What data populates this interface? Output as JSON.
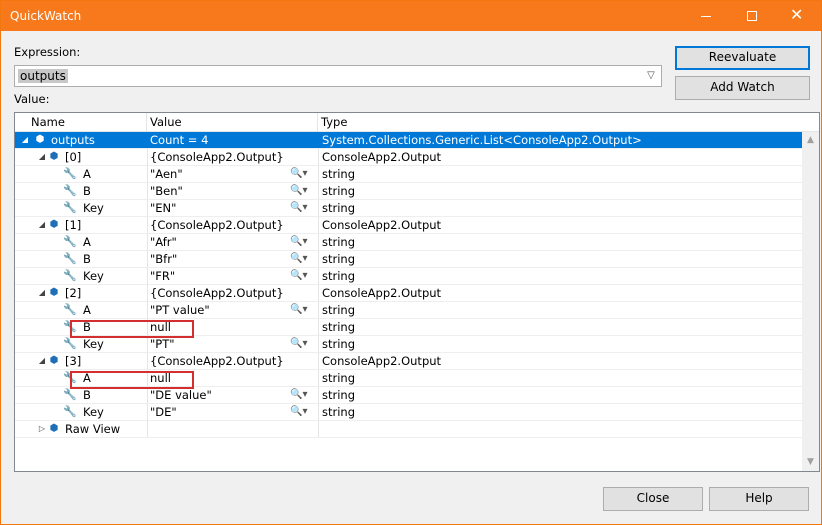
{
  "window": {
    "title": "QuickWatch"
  },
  "expression": {
    "label": "Expression:",
    "value": "outputs"
  },
  "value_label": "Value:",
  "buttons": {
    "reevaluate": "Reevaluate",
    "add_watch": "Add Watch",
    "close": "Close",
    "help": "Help"
  },
  "grid": {
    "columns": [
      "Name",
      "Value",
      "Type"
    ],
    "rows": [
      {
        "name": "outputs",
        "value": "Count = 4",
        "type": "System.Collections.Generic.List<ConsoleApp2.Output>",
        "icon": "object-icon",
        "expander": "expanded",
        "level": 0,
        "selected": true
      },
      {
        "name": "[0]",
        "value": "{ConsoleApp2.Output}",
        "type": "ConsoleApp2.Output",
        "icon": "object-icon",
        "expander": "expanded",
        "level": 1
      },
      {
        "name": "A",
        "value": "\"Aen\"",
        "type": "string",
        "icon": "wrench-icon",
        "level": 2,
        "magnifier": true
      },
      {
        "name": "B",
        "value": "\"Ben\"",
        "type": "string",
        "icon": "wrench-icon",
        "level": 2,
        "magnifier": true
      },
      {
        "name": "Key",
        "value": "\"EN\"",
        "type": "string",
        "icon": "wrench-icon",
        "level": 2,
        "magnifier": true
      },
      {
        "name": "[1]",
        "value": "{ConsoleApp2.Output}",
        "type": "ConsoleApp2.Output",
        "icon": "object-icon",
        "expander": "expanded",
        "level": 1
      },
      {
        "name": "A",
        "value": "\"Afr\"",
        "type": "string",
        "icon": "wrench-icon",
        "level": 2,
        "magnifier": true
      },
      {
        "name": "B",
        "value": "\"Bfr\"",
        "type": "string",
        "icon": "wrench-icon",
        "level": 2,
        "magnifier": true
      },
      {
        "name": "Key",
        "value": "\"FR\"",
        "type": "string",
        "icon": "wrench-icon",
        "level": 2,
        "magnifier": true
      },
      {
        "name": "[2]",
        "value": "{ConsoleApp2.Output}",
        "type": "ConsoleApp2.Output",
        "icon": "object-icon",
        "expander": "expanded",
        "level": 1
      },
      {
        "name": "A",
        "value": "\"PT value\"",
        "type": "string",
        "icon": "wrench-icon",
        "level": 2,
        "magnifier": true
      },
      {
        "name": "B",
        "value": "null",
        "type": "string",
        "icon": "wrench-icon",
        "level": 2,
        "highlighted": true
      },
      {
        "name": "Key",
        "value": "\"PT\"",
        "type": "string",
        "icon": "wrench-icon",
        "level": 2,
        "magnifier": true
      },
      {
        "name": "[3]",
        "value": "{ConsoleApp2.Output}",
        "type": "ConsoleApp2.Output",
        "icon": "object-icon",
        "expander": "expanded",
        "level": 1
      },
      {
        "name": "A",
        "value": "null",
        "type": "string",
        "icon": "wrench-icon",
        "level": 2,
        "highlighted": true
      },
      {
        "name": "B",
        "value": "\"DE value\"",
        "type": "string",
        "icon": "wrench-icon",
        "level": 2,
        "magnifier": true
      },
      {
        "name": "Key",
        "value": "\"DE\"",
        "type": "string",
        "icon": "wrench-icon",
        "level": 2,
        "magnifier": true
      },
      {
        "name": "Raw View",
        "value": "",
        "type": "",
        "icon": "object-icon",
        "expander": "collapsed",
        "level": 1
      }
    ]
  },
  "colors": {
    "titlebar": "#f7791b",
    "selection": "#0078d7",
    "highlight_box": "#d32f2f"
  }
}
